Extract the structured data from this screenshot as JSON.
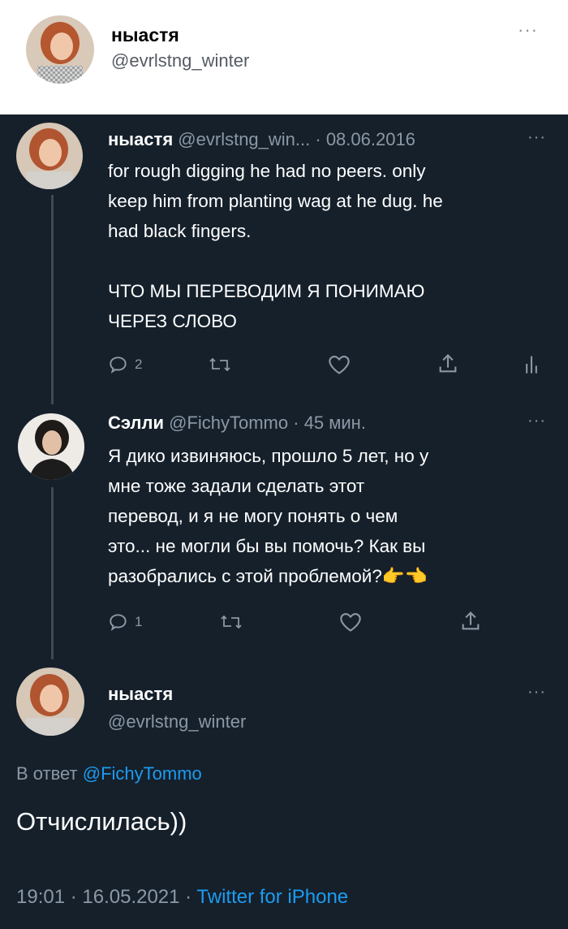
{
  "header": {
    "name": "ныастя",
    "handle": "@evrlstng_winter",
    "more": "···"
  },
  "tweet1": {
    "name": "ныастя",
    "handle": "@evrlstng_win...",
    "date": "· 08.06.2016",
    "more": "···",
    "lines": [
      "for rough digging he had no peers. only",
      "keep him from planting wag at he dug. he",
      "had black fingers.",
      "",
      "ЧТО МЫ ПЕРЕВОДИМ Я ПОНИМАЮ",
      "ЧЕРЕЗ СЛОВО"
    ],
    "reply_count": "2"
  },
  "tweet2": {
    "name": "Сэлли",
    "handle": "@FichyTommo",
    "time": "· 45 мин.",
    "more": "···",
    "lines": [
      "Я дико извиняюсь, прошло 5 лет, но у",
      "мне тоже задали сделать этот",
      "перевод, и я не могу понять о чем",
      "это... не могли бы вы помочь? Как вы",
      "разобрались с этой проблемой?👉👈"
    ],
    "reply_count": "1"
  },
  "main_tweet": {
    "name": "ныастя",
    "handle": "@evrlstng_winter",
    "more": "···",
    "reply_prefix": "В ответ",
    "reply_to": "@FichyTommo",
    "text": "Отчислилась))",
    "timestamp": "19:01 · 16.05.2021 ·",
    "client": "Twitter for iPhone"
  },
  "colors": {
    "background": "#15202b",
    "accent": "#1d9bf0",
    "muted": "#8b98a5"
  },
  "icons": [
    "reply-icon",
    "retweet-icon",
    "like-icon",
    "share-icon",
    "analytics-icon",
    "more-icon"
  ]
}
